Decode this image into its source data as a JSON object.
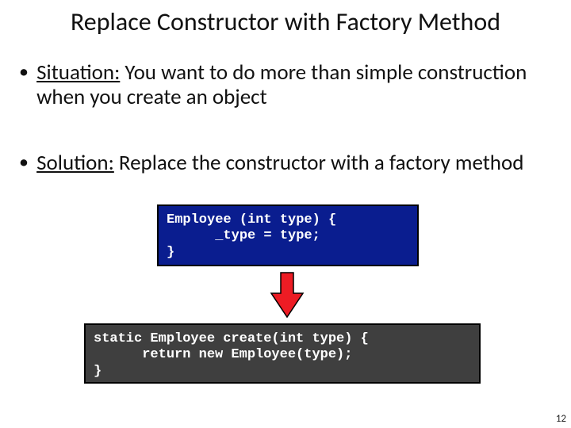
{
  "title": "Replace Constructor with Factory Method",
  "bullets": {
    "situation_label": "Situation:",
    "situation_text": " You want to do more than simple construction when you create an object",
    "solution_label": "Solution:",
    "solution_text": " Replace the constructor with a factory method"
  },
  "code": {
    "before": "Employee (int type) {\n      _type = type;\n}",
    "after": "static Employee create(int type) {\n      return new Employee(type);\n}"
  },
  "page_number": "12"
}
